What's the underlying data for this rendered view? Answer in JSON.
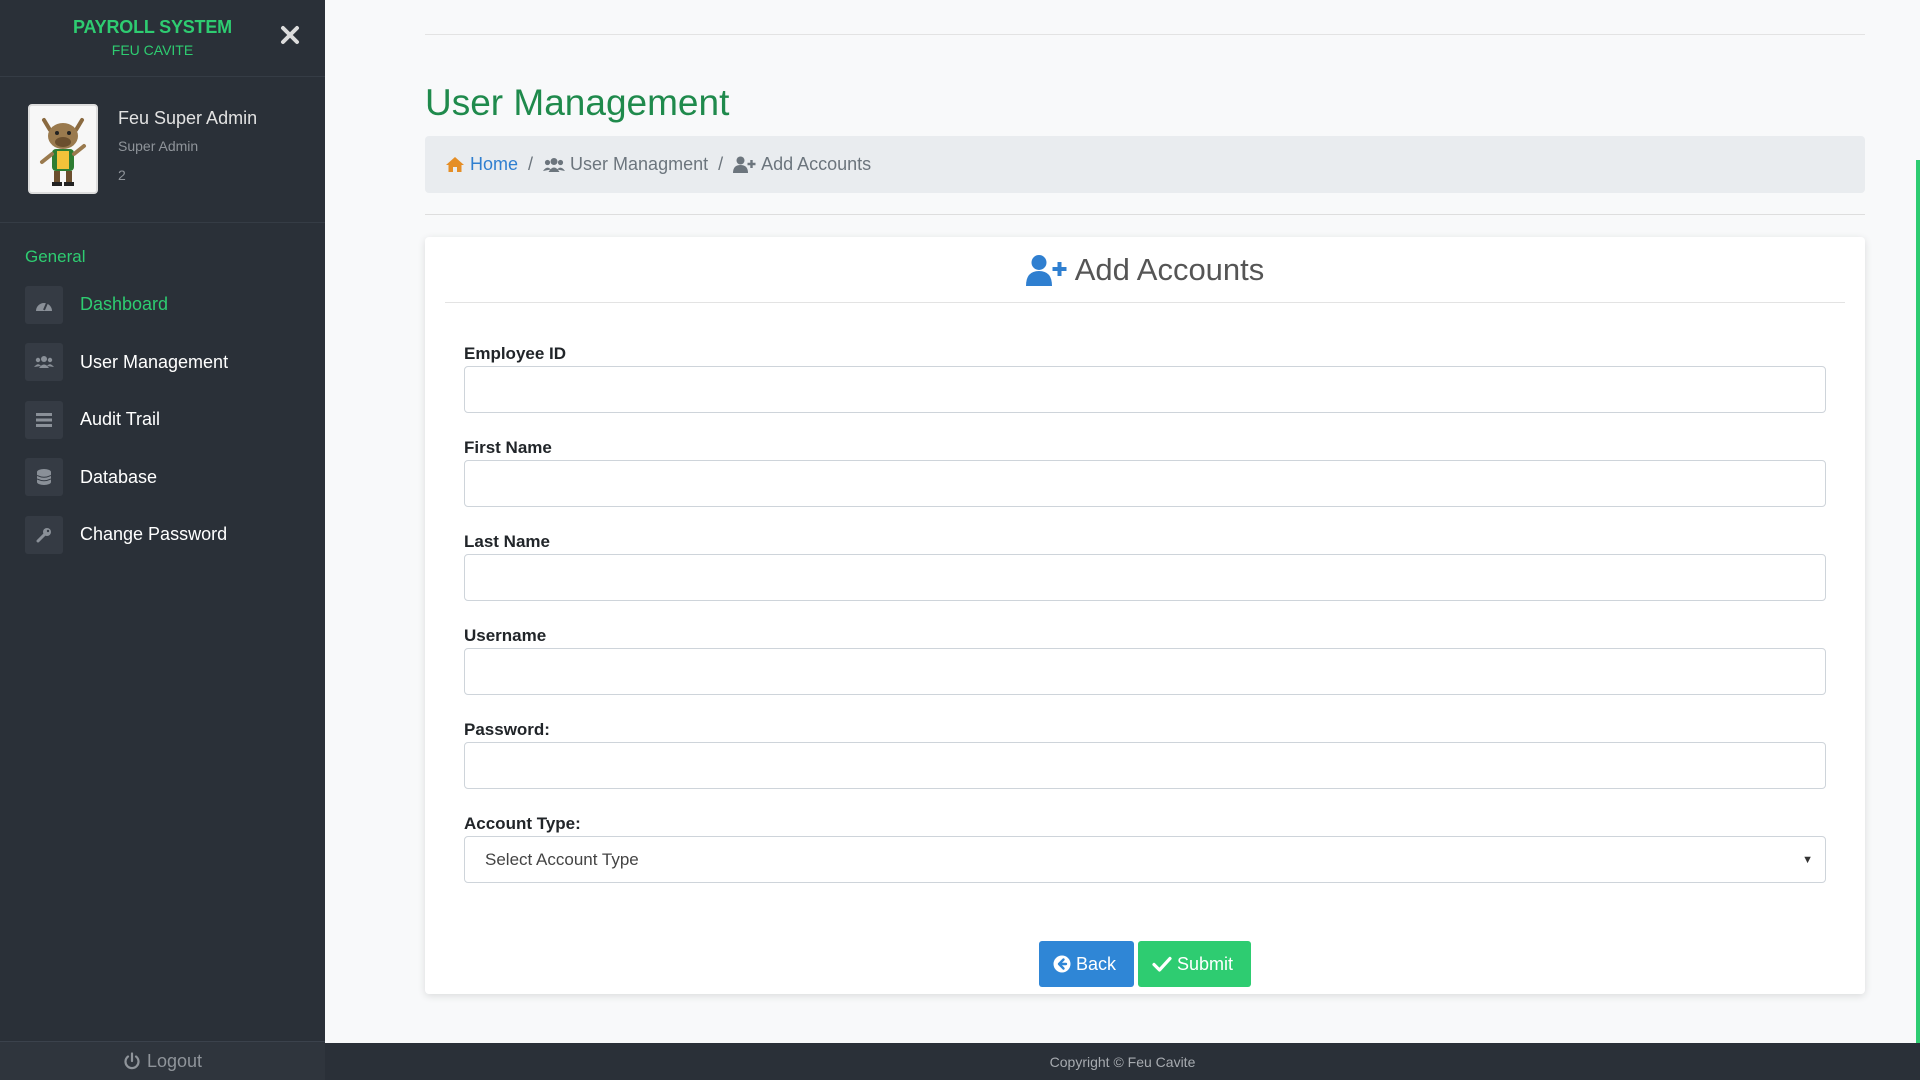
{
  "brand": {
    "title": "PAYROLL SYSTEM",
    "subtitle": "FEU CAVITE"
  },
  "profile": {
    "name": "Feu Super Admin",
    "role": "Super Admin",
    "id": "2"
  },
  "sidebar": {
    "heading": "General",
    "items": [
      {
        "label": "Dashboard",
        "icon": "dashboard-icon",
        "active": true
      },
      {
        "label": "User Management",
        "icon": "users-icon"
      },
      {
        "label": "Audit Trail",
        "icon": "list-icon"
      },
      {
        "label": "Database",
        "icon": "database-icon"
      },
      {
        "label": "Change Password",
        "icon": "key-icon"
      }
    ],
    "logout": "Logout"
  },
  "page": {
    "title": "User Management"
  },
  "breadcrumb": {
    "home": "Home",
    "section": "User Managment",
    "current": "Add Accounts"
  },
  "card": {
    "title": "Add Accounts"
  },
  "form": {
    "employee_id_label": "Employee ID",
    "first_name_label": "First Name",
    "last_name_label": "Last Name",
    "username_label": "Username",
    "password_label": "Password:",
    "account_type_label": "Account Type:",
    "account_type_value": "Select Account Type",
    "employee_id": "",
    "first_name": "",
    "last_name": "",
    "username": "",
    "password": ""
  },
  "buttons": {
    "back": "Back",
    "submit": "Submit"
  },
  "footer": {
    "text": "Copyright © Feu Cavite"
  },
  "colors": {
    "accent_green": "#2ecc71",
    "title_green": "#1f8a4c",
    "link_blue": "#2f7fd0",
    "sidebar_bg": "#2a3038"
  }
}
